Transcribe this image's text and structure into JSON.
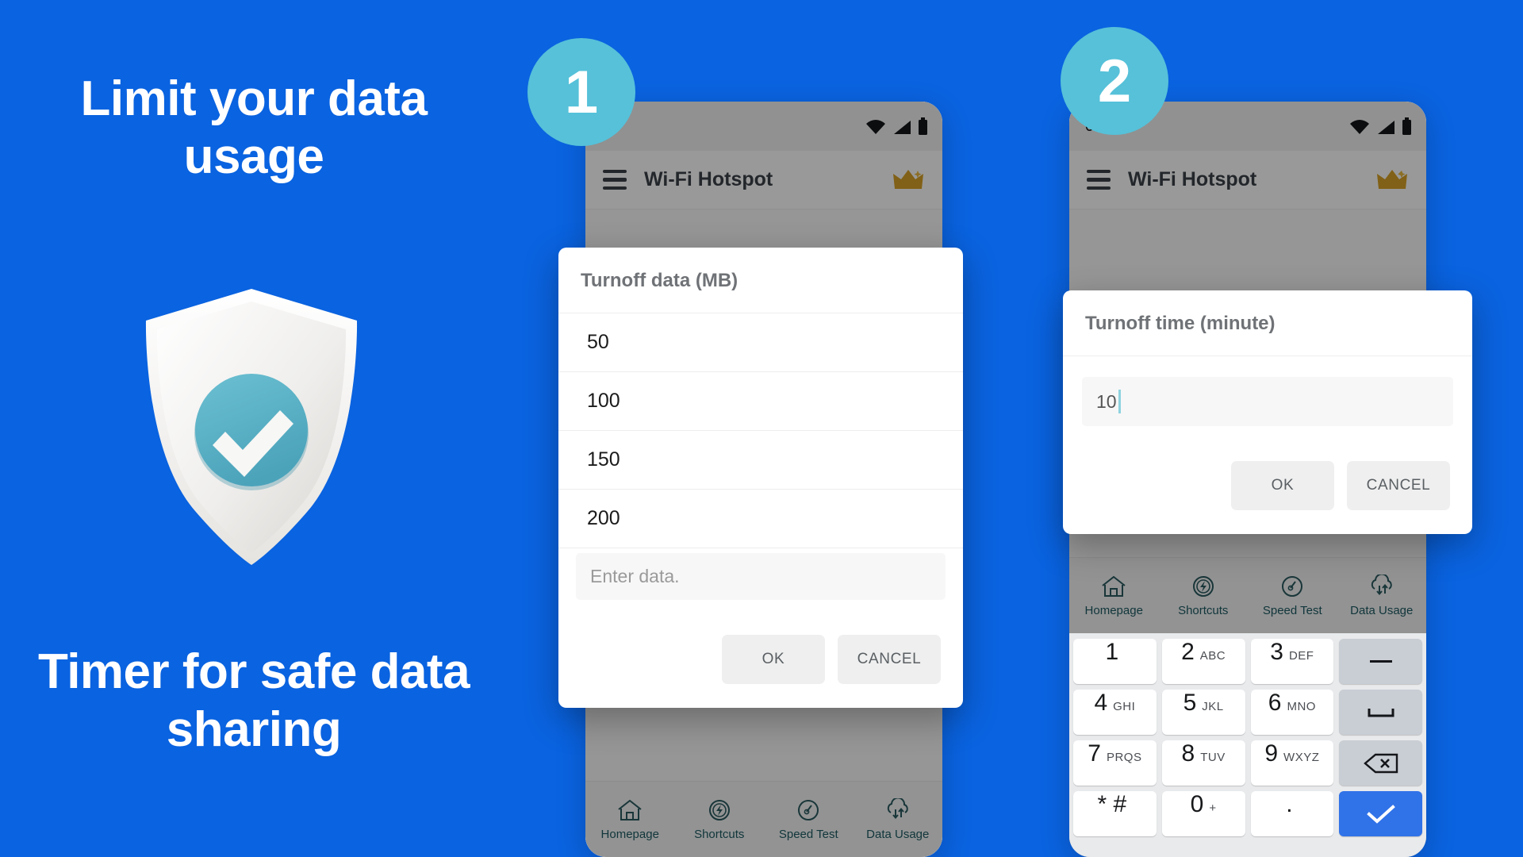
{
  "colors": {
    "background_blue": "#0A63E0",
    "badge_teal": "#56C1D9",
    "shield_white": "#F0EFED",
    "check_circle_teal": "#56AEC4",
    "crown_gold": "#D8A227",
    "keyboard_accent_blue": "#3072E8",
    "caret_teal": "#8ED3E0"
  },
  "promo": {
    "headline": "Limit your data usage",
    "footline": "Timer for safe data sharing",
    "illustration": "shield-check-icon"
  },
  "steps": [
    {
      "number": "1"
    },
    {
      "number": "2"
    }
  ],
  "phone_1": {
    "status_bar": {
      "clock": "0",
      "icons": [
        "wifi-icon",
        "signal-icon",
        "battery-icon"
      ]
    },
    "app_bar": {
      "menu_icon": "hamburger-menu-icon",
      "title": "Wi-Fi Hotspot",
      "premium_icon": "crown-icon"
    },
    "bottom_nav": [
      {
        "label": "Homepage",
        "icon": "home-icon"
      },
      {
        "label": "Shortcuts",
        "icon": "gear-lightning-icon"
      },
      {
        "label": "Speed Test",
        "icon": "gauge-icon"
      },
      {
        "label": "Data Usage",
        "icon": "cloud-arrows-icon"
      }
    ],
    "dialog": {
      "title": "Turnoff data (MB)",
      "options": [
        "50",
        "100",
        "150",
        "200"
      ],
      "input_placeholder": "Enter data.",
      "input_value": "",
      "ok_label": "OK",
      "cancel_label": "CANCEL"
    }
  },
  "phone_2": {
    "status_bar": {
      "clock": "0",
      "icons": [
        "wifi-icon",
        "signal-icon",
        "battery-icon"
      ]
    },
    "app_bar": {
      "menu_icon": "hamburger-menu-icon",
      "title": "Wi-Fi Hotspot",
      "premium_icon": "crown-icon"
    },
    "bottom_nav": [
      {
        "label": "Homepage",
        "icon": "home-icon"
      },
      {
        "label": "Shortcuts",
        "icon": "gear-lightning-icon"
      },
      {
        "label": "Speed Test",
        "icon": "gauge-icon"
      },
      {
        "label": "Data Usage",
        "icon": "cloud-arrows-icon"
      }
    ],
    "dialog": {
      "title": "Turnoff time (minute)",
      "input_value": "10",
      "ok_label": "OK",
      "cancel_label": "CANCEL"
    },
    "keyboard": {
      "rows": [
        [
          {
            "num": "1",
            "sub": ""
          },
          {
            "num": "2",
            "sub": "ABC"
          },
          {
            "num": "3",
            "sub": "DEF"
          },
          {
            "num": "–",
            "sub": "",
            "type": "fn",
            "icon": "dash-key-icon"
          }
        ],
        [
          {
            "num": "4",
            "sub": "GHI"
          },
          {
            "num": "5",
            "sub": "JKL"
          },
          {
            "num": "6",
            "sub": "MNO"
          },
          {
            "num": "⌴",
            "sub": "",
            "type": "fn",
            "icon": "space-key-icon"
          }
        ],
        [
          {
            "num": "7",
            "sub": "PRQS"
          },
          {
            "num": "8",
            "sub": "TUV"
          },
          {
            "num": "9",
            "sub": "WXYZ"
          },
          {
            "num": "",
            "sub": "",
            "type": "fn",
            "icon": "backspace-key-icon"
          }
        ],
        [
          {
            "num": "* #",
            "sub": ""
          },
          {
            "num": "0",
            "sub": "+"
          },
          {
            "num": ".",
            "sub": ""
          },
          {
            "num": "",
            "sub": "",
            "type": "accent",
            "icon": "check-key-icon"
          }
        ]
      ]
    }
  }
}
